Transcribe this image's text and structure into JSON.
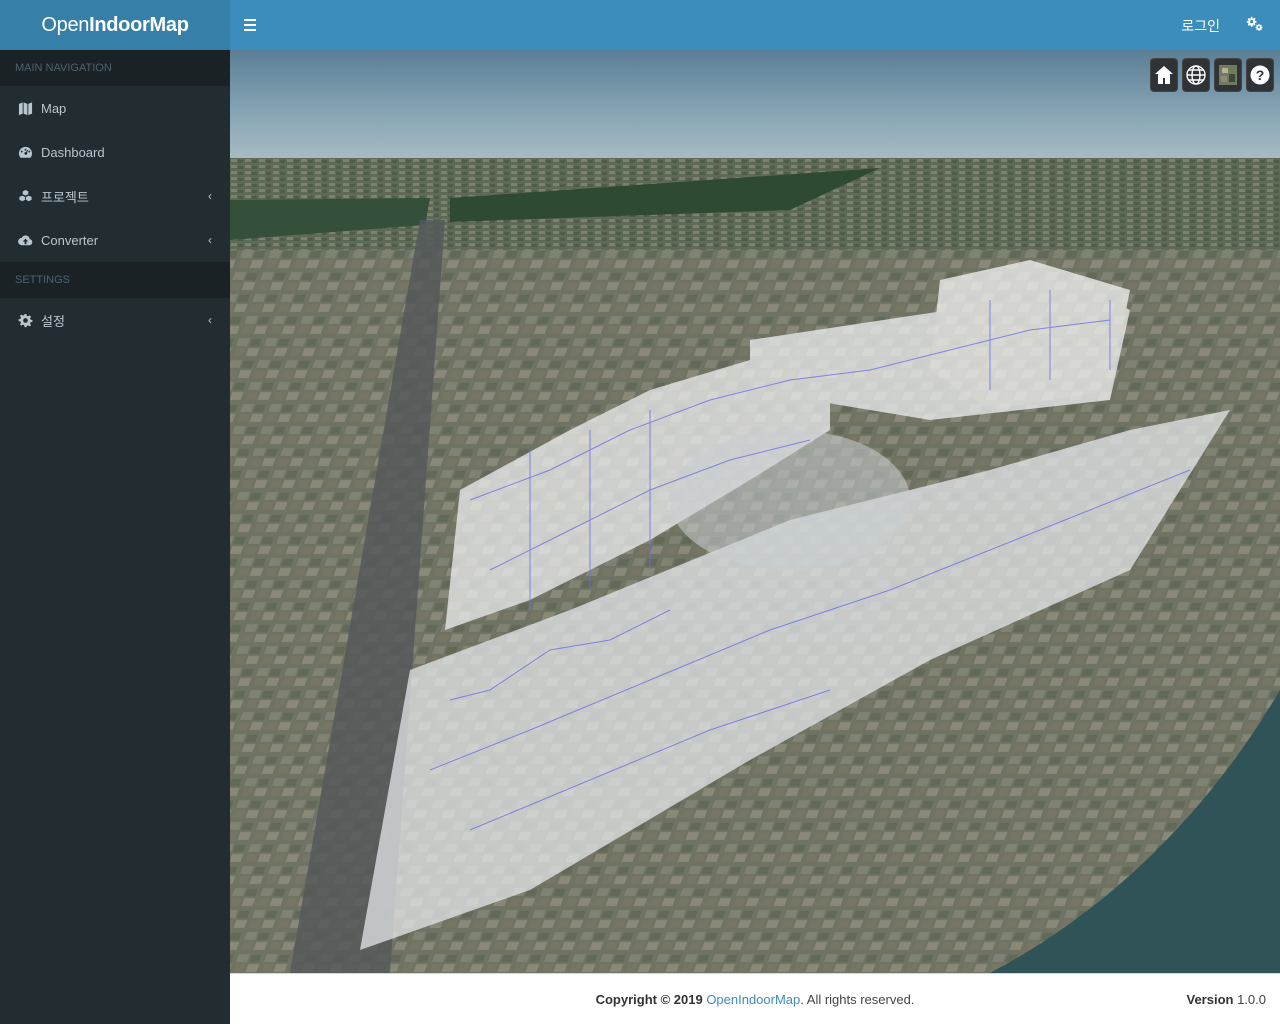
{
  "app": {
    "logo_light": "Open",
    "logo_bold1": "Indoor",
    "logo_bold2": "Map"
  },
  "sidebar": {
    "main_header": "MAIN NAVIGATION",
    "items": [
      {
        "label": "Map",
        "icon": "map-icon",
        "has_submenu": false
      },
      {
        "label": "Dashboard",
        "icon": "dashboard-icon",
        "has_submenu": false
      },
      {
        "label": "프로젝트",
        "icon": "cubes-icon",
        "has_submenu": true
      },
      {
        "label": "Converter",
        "icon": "cloud-upload-icon",
        "has_submenu": true
      }
    ],
    "settings_header": "SETTINGS",
    "settings_items": [
      {
        "label": "설정",
        "icon": "gear-icon",
        "has_submenu": true
      }
    ]
  },
  "header": {
    "login_label": "로그인",
    "accent": "#3c8dbc",
    "logo_bg": "#367fa9"
  },
  "map": {
    "tools": [
      "home-icon",
      "globe-icon",
      "layer-picker-icon",
      "help-icon"
    ]
  },
  "footer": {
    "copyright_prefix": "Copyright © 2019",
    "copyright_link": "OpenIndoorMap",
    "copyright_suffix": ". All rights reserved.",
    "version_label": "Version",
    "version_value": "1.0.0"
  }
}
